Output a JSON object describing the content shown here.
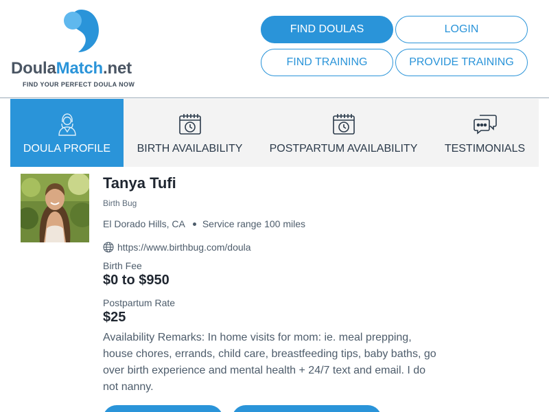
{
  "brand": {
    "name_part1": "Doula",
    "name_part2": "Match",
    "name_part3": ".net",
    "tagline": "FIND YOUR PERFECT DOULA NOW",
    "colors": {
      "accent": "#2a94d9",
      "light_accent": "#5fb8ee",
      "text_dark": "#4a5563"
    }
  },
  "nav": {
    "find_doulas": "FIND DOULAS",
    "login": "LOGIN",
    "find_training": "FIND TRAINING",
    "provide_training": "PROVIDE TRAINING"
  },
  "tabs": [
    {
      "label": "DOULA PROFILE",
      "icon": "doula-person-icon",
      "active": true
    },
    {
      "label": "BIRTH AVAILABILITY",
      "icon": "calendar-clock-icon",
      "active": false
    },
    {
      "label": "POSTPARTUM AVAILABILITY",
      "icon": "calendar-clock-icon",
      "active": false
    },
    {
      "label": "TESTIMONIALS",
      "icon": "chat-bubbles-icon",
      "active": false
    }
  ],
  "profile": {
    "name": "Tanya Tufi",
    "organization": "Birth Bug",
    "location": "El Dorado Hills, CA",
    "service_range": "Service range 100 miles",
    "website": "https://www.birthbug.com/doula",
    "birth_fee_label": "Birth Fee",
    "birth_fee": "$0 to $950",
    "postpartum_rate_label": "Postpartum Rate",
    "postpartum_rate": "$25",
    "remarks": "Availability Remarks: In home visits for mom: ie. meal prepping, house chores, errands, child care, breastfeeding tips, baby baths, go over birth experience and mental health + 24/7 text and email. I do not nanny."
  }
}
